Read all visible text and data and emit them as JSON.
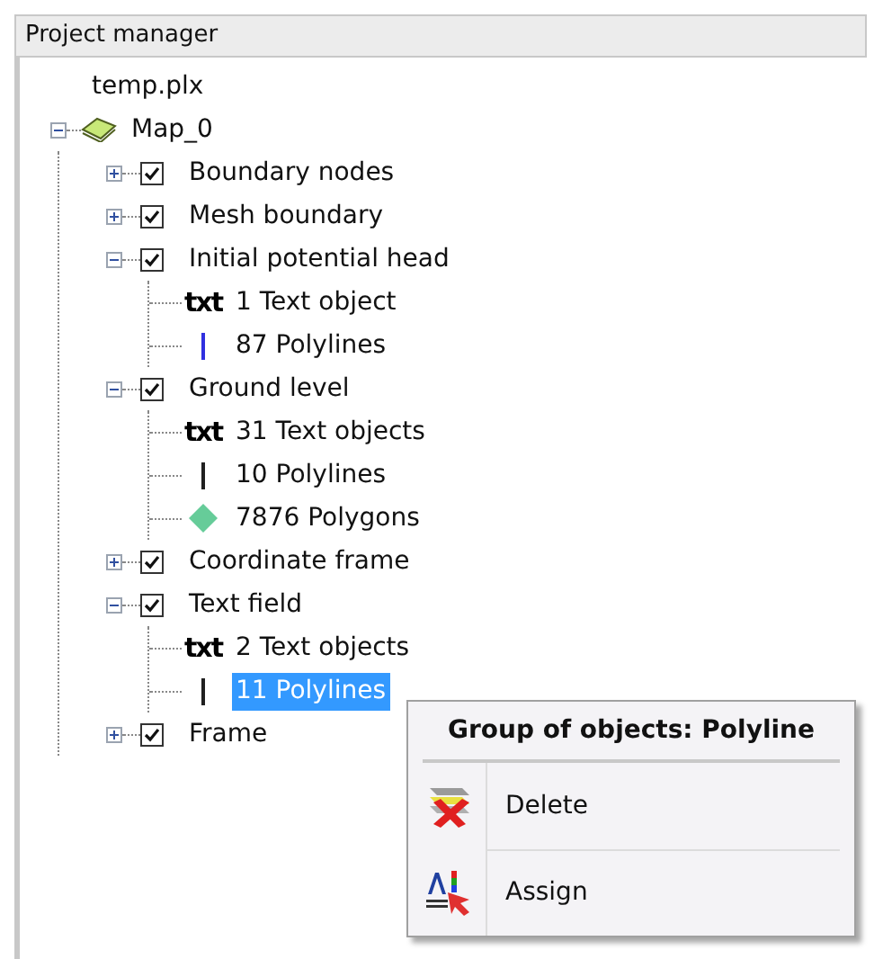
{
  "panel": {
    "title": "Project manager"
  },
  "tree": {
    "root": "temp.plx",
    "map": {
      "label": "Map_0",
      "expanded": true
    },
    "layers": [
      {
        "label": "Boundary nodes",
        "checked": true,
        "expanded": false
      },
      {
        "label": "Mesh boundary",
        "checked": true,
        "expanded": false
      },
      {
        "label": "Initial potential head",
        "checked": true,
        "expanded": true,
        "children": [
          {
            "kind": "text",
            "icon_label": "txt",
            "label": "1 Text object",
            "selected": false
          },
          {
            "kind": "polyline",
            "color": "#3030e0",
            "label": "87 Polylines",
            "selected": false
          }
        ]
      },
      {
        "label": "Ground level",
        "checked": true,
        "expanded": true,
        "children": [
          {
            "kind": "text",
            "icon_label": "txt",
            "label": "31 Text objects",
            "selected": false
          },
          {
            "kind": "polyline",
            "color": "#202020",
            "label": "10 Polylines",
            "selected": false
          },
          {
            "kind": "polygon",
            "color": "#66cc99",
            "label": "7876 Polygons",
            "selected": false
          }
        ]
      },
      {
        "label": "Coordinate frame",
        "checked": true,
        "expanded": false
      },
      {
        "label": "Text field",
        "checked": true,
        "expanded": true,
        "children": [
          {
            "kind": "text",
            "icon_label": "txt",
            "label": "2 Text objects",
            "selected": false
          },
          {
            "kind": "polyline",
            "color": "#202020",
            "label": "11 Polylines",
            "selected": true
          }
        ]
      },
      {
        "label": "Frame",
        "checked": true,
        "expanded": false
      }
    ]
  },
  "context_menu": {
    "title": "Group of objects: Polyline",
    "items": [
      {
        "kind": "delete",
        "label": "Delete"
      },
      {
        "kind": "assign",
        "label": "Assign"
      }
    ]
  }
}
